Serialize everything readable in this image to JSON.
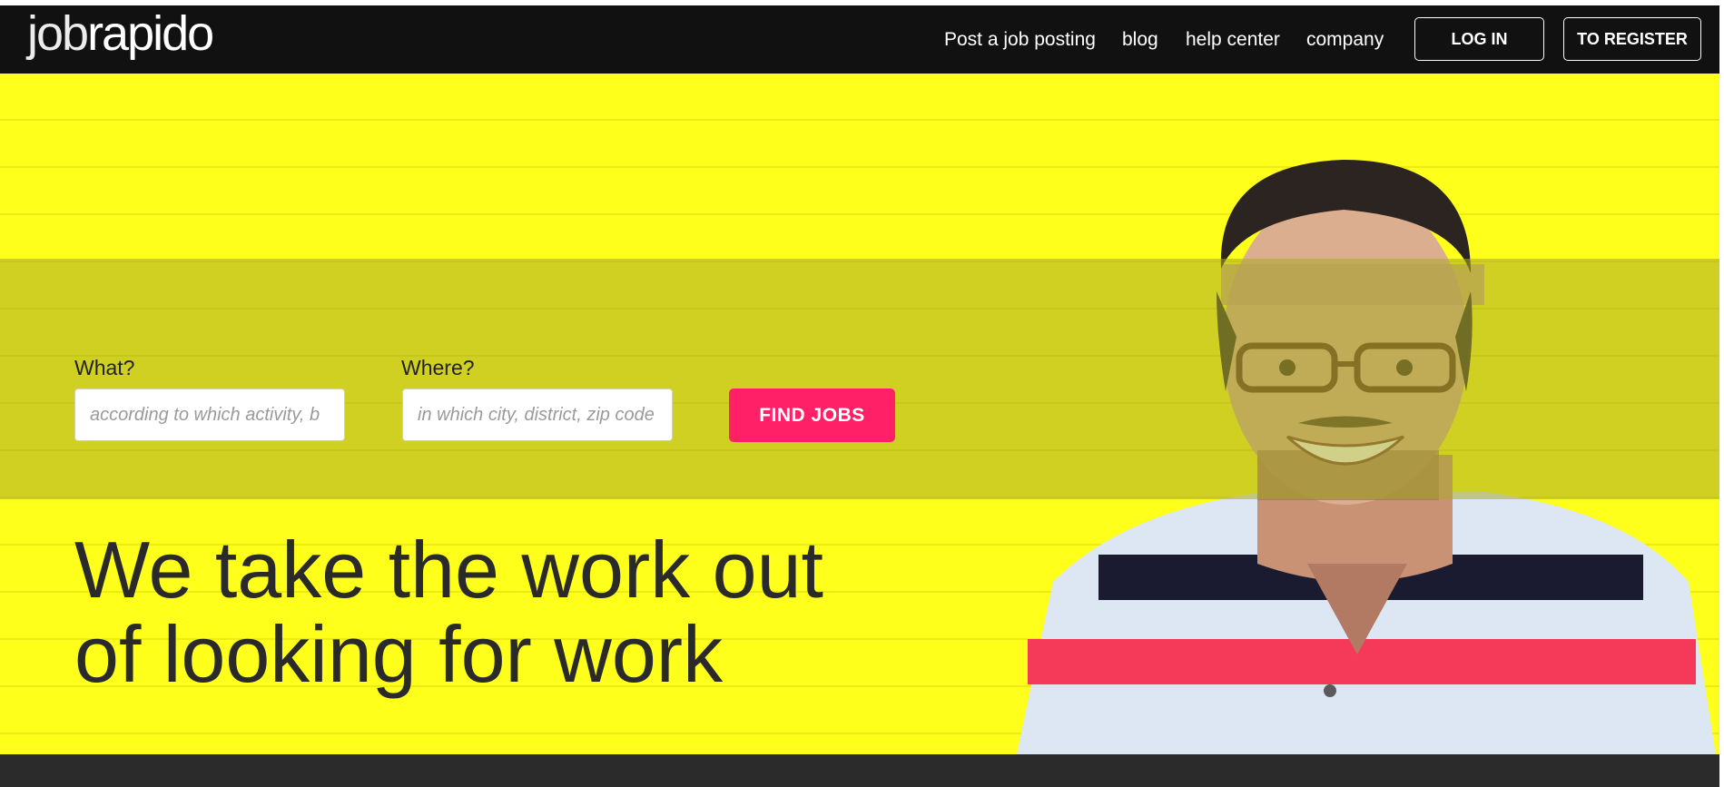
{
  "brand": {
    "logo_left": "job",
    "logo_right": "rapido"
  },
  "nav": {
    "links": [
      {
        "label": "Post a job posting"
      },
      {
        "label": "blog"
      },
      {
        "label": "help center"
      },
      {
        "label": "company"
      }
    ],
    "login_label": "LOG IN",
    "register_label": "TO REGISTER"
  },
  "search": {
    "what_label": "What?",
    "what_placeholder": "according to which activity, b",
    "where_label": "Where?",
    "where_placeholder": "in which city, district, zip code",
    "submit_label": "FIND JOBS"
  },
  "hero": {
    "headline_line1": "We take the work out",
    "headline_line2": "of looking for work"
  },
  "colors": {
    "accent": "#ff2068",
    "hero_background": "#ffff1c",
    "navbar": "#111111"
  }
}
